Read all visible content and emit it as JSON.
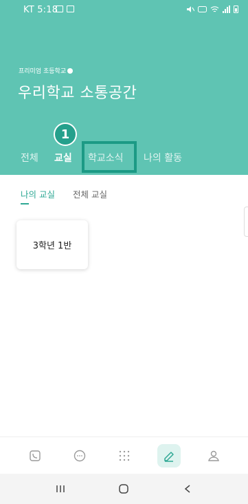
{
  "status_bar": {
    "time": "KT 5:18"
  },
  "header": {
    "brand": "프리미엄 초등학교",
    "title": "우리학교 소통공간",
    "tabs": [
      {
        "label": "전체"
      },
      {
        "label": "교실"
      },
      {
        "label": "학교소식"
      },
      {
        "label": "나의 활동"
      }
    ],
    "active_tab": "교실"
  },
  "annotation": {
    "badge_number": "1",
    "accent_color": "#1c9a85"
  },
  "subtabs": [
    {
      "label": "나의 교실"
    },
    {
      "label": "전체 교실"
    }
  ],
  "classes": [
    {
      "label": "3학년 1반"
    }
  ],
  "bottom_nav": [
    {
      "icon": "phone-icon"
    },
    {
      "icon": "chat-icon"
    },
    {
      "icon": "grid-dots-icon"
    },
    {
      "icon": "pencil-icon",
      "active": true
    },
    {
      "icon": "person-icon"
    }
  ],
  "colors": {
    "header_bg": "#5fc4b3",
    "accent": "#2ea894"
  }
}
